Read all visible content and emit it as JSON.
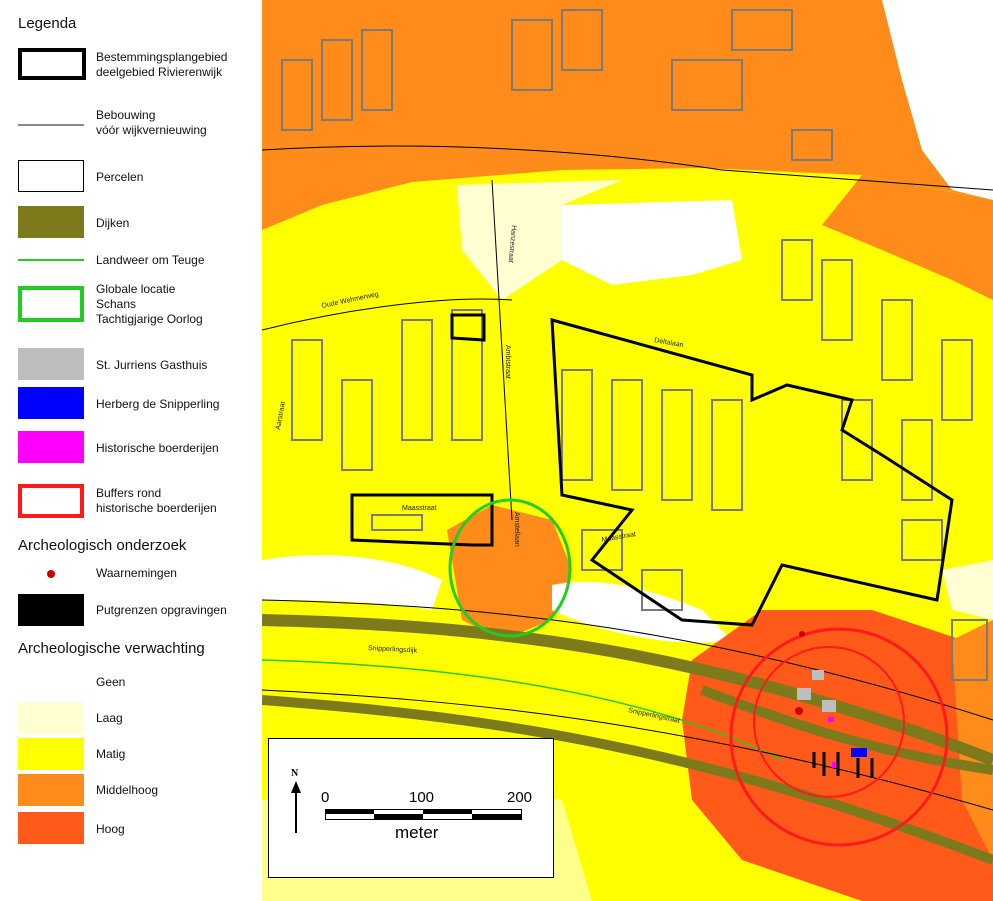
{
  "legend": {
    "title": "Legenda",
    "items": [
      {
        "label": "Bestemmingsplangebied\ndeelgebied Rivierenwijk"
      },
      {
        "label": "Bebouwing\nvóór wijkvernieuwing"
      },
      {
        "label": "Percelen"
      },
      {
        "label": "Dijken"
      },
      {
        "label": "Landweer om Teuge"
      },
      {
        "label": "Globale locatie\nSchans\nTachtigjarige Oorlog"
      },
      {
        "label": "St. Jurriens Gasthuis"
      },
      {
        "label": "Herberg de Snipperling"
      },
      {
        "label": "Historische boerderijen"
      },
      {
        "label": "Buffers rond\nhistorische boerderijen"
      }
    ],
    "section_onderzoek": "Archeologisch onderzoek",
    "onderzoek_items": [
      {
        "label": "Waarnemingen"
      },
      {
        "label": "Putgrenzen opgravingen"
      }
    ],
    "section_verwachting": "Archeologische verwachting",
    "verwachting_items": [
      {
        "label": "Geen"
      },
      {
        "label": "Laag"
      },
      {
        "label": "Matig"
      },
      {
        "label": "Middelhoog"
      },
      {
        "label": "Hoog"
      }
    ]
  },
  "colors": {
    "geen": "#ffffff",
    "laag": "#ffffd2",
    "matig": "#ffff00",
    "middelhoog": "#ff8c1a",
    "hoog": "#ff5a1a",
    "dijken": "#7d7a1c",
    "landweer": "#22cc22",
    "schans": "#22cc22",
    "gasthuis": "#bebebe",
    "herberg": "#0000ff",
    "boerderijen": "#ff00ff",
    "buffers": "#ff1a1a",
    "waarnemingen": "#cc0000",
    "plangebied": "#000000",
    "bebouwing": "#7a7a7a"
  },
  "map": {
    "streets": [
      "Oude Wehmerweg",
      "Aarstraat",
      "Ambtstraat",
      "Deltalaan",
      "Maasstraat",
      "Maasstraat",
      "Snipperlingsdijk",
      "Snipperlingstraat",
      "Amstellaan",
      "Hanzestraat"
    ]
  },
  "scalebar": {
    "north": "N",
    "ticks": [
      "0",
      "100",
      "200"
    ],
    "unit": "meter"
  }
}
